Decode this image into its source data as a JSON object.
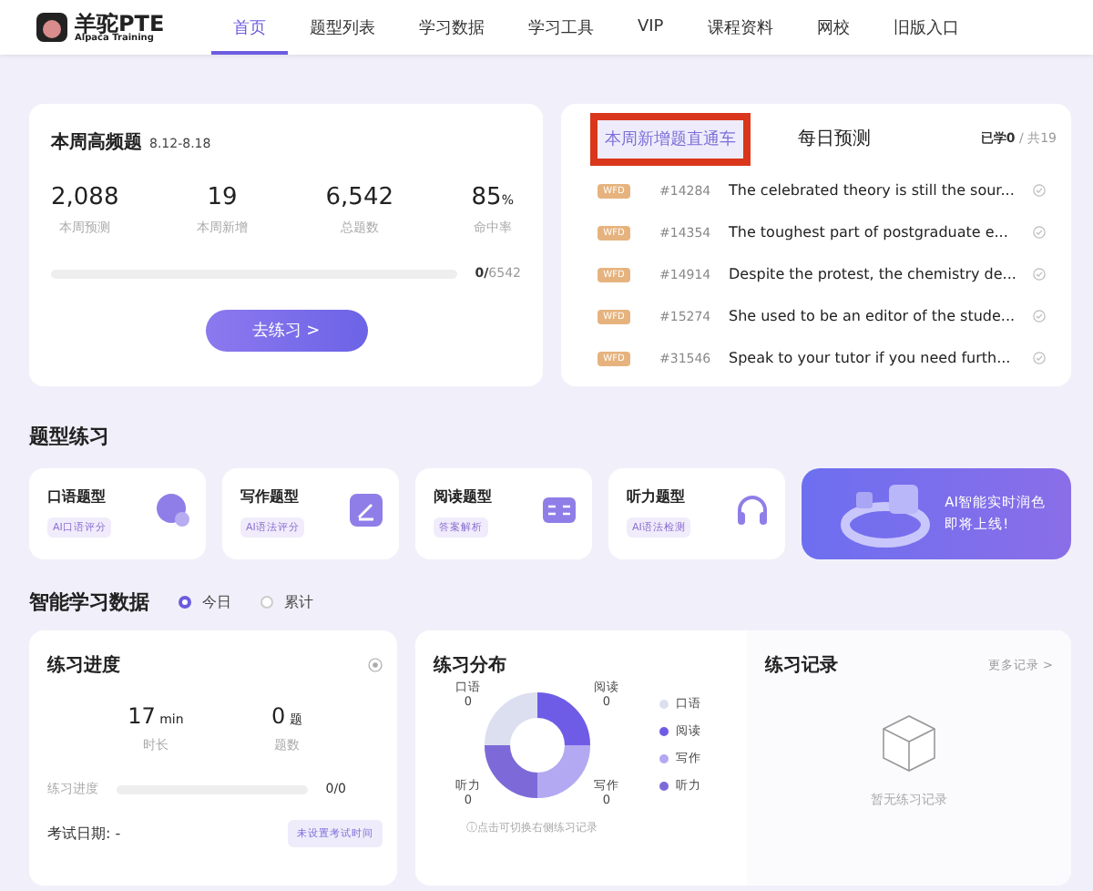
{
  "header": {
    "logo_title": "羊驼PTE",
    "logo_subtitle": "Alpaca Training",
    "nav": [
      {
        "label": "首页",
        "selected": true
      },
      {
        "label": "题型列表",
        "selected": false
      },
      {
        "label": "学习数据",
        "selected": false
      },
      {
        "label": "学习工具",
        "selected": false
      },
      {
        "label": "VIP",
        "selected": false
      },
      {
        "label": "课程资料",
        "selected": false
      },
      {
        "label": "网校",
        "selected": false
      },
      {
        "label": "旧版入口",
        "selected": false
      }
    ]
  },
  "weekly": {
    "title": "本周高频题",
    "range": "8.12-8.18",
    "stats": [
      {
        "value": "2,088",
        "label": "本周预测"
      },
      {
        "value": "19",
        "label": "本周新增"
      },
      {
        "value": "6,542",
        "label": "总题数"
      },
      {
        "value": "85",
        "unit": "%",
        "label": "命中率"
      }
    ],
    "progress": {
      "level": 0,
      "done": "0/",
      "total": "6542"
    },
    "button": "去练习 >"
  },
  "questions": {
    "tabs": [
      {
        "label": "本周新增题直通车",
        "selected": true,
        "highlighted": true
      },
      {
        "label": "每日预测",
        "selected": false,
        "highlighted": false
      }
    ],
    "learned": "已学0",
    "total": " / 共19",
    "rows": [
      {
        "tag": "WFD",
        "id": "#14284",
        "text": "The celebrated theory is still the sour...",
        "done": false
      },
      {
        "tag": "WFD",
        "id": "#14354",
        "text": "The toughest part of postgraduate e...",
        "done": false
      },
      {
        "tag": "WFD",
        "id": "#14914",
        "text": "Despite the protest, the chemistry de...",
        "done": false
      },
      {
        "tag": "WFD",
        "id": "#15274",
        "text": "She used to be an editor of the stude...",
        "done": false
      },
      {
        "tag": "WFD",
        "id": "#31546",
        "text": "Speak to your tutor if you need furth...",
        "done": false
      }
    ]
  },
  "practice": {
    "title": "题型练习",
    "cards": [
      {
        "kind": "speaking",
        "title": "口语题型",
        "tag": "AI口语评分"
      },
      {
        "kind": "writing",
        "title": "写作题型",
        "tag": "AI语法评分"
      },
      {
        "kind": "reading",
        "title": "阅读题型",
        "tag": "答案解析"
      },
      {
        "kind": "listening",
        "title": "听力题型",
        "tag": "AI语法检测"
      }
    ],
    "promo": {
      "lines": [
        "AI智能实时润色",
        "即将上线!"
      ]
    }
  },
  "data": {
    "title": "智能学习数据",
    "options": [
      {
        "label": "今日",
        "selected": true
      },
      {
        "label": "累计",
        "selected": false
      }
    ],
    "progress": {
      "title": "练习进度",
      "stats": [
        {
          "value": "17",
          "unit": "min",
          "label": "时长"
        },
        {
          "value": "0",
          "unit": "题",
          "label": "题数"
        }
      ],
      "bar_label": "练习进度",
      "level": 0,
      "count": "0/0",
      "exam_label": "考试日期:",
      "exam_value": "-",
      "exam_button": "未设置考试时间"
    },
    "distribution": {
      "title": "练习分布",
      "labels": [
        {
          "name": "口语",
          "value": "0"
        },
        {
          "name": "阅读",
          "value": "0"
        },
        {
          "name": "听力",
          "value": "0"
        },
        {
          "name": "写作",
          "value": "0"
        }
      ],
      "legend": [
        {
          "label": "口语",
          "color": "#dcdff0"
        },
        {
          "label": "阅读",
          "color": "#6f5ce6"
        },
        {
          "label": "写作",
          "color": "#b3a9f2"
        },
        {
          "label": "听力",
          "color": "#7d6ad8"
        }
      ],
      "hint": "ⓘ点击可切换右侧练习记录"
    },
    "records": {
      "title": "练习记录",
      "more": "更多记录 >",
      "empty": "暂无练习记录"
    }
  }
}
